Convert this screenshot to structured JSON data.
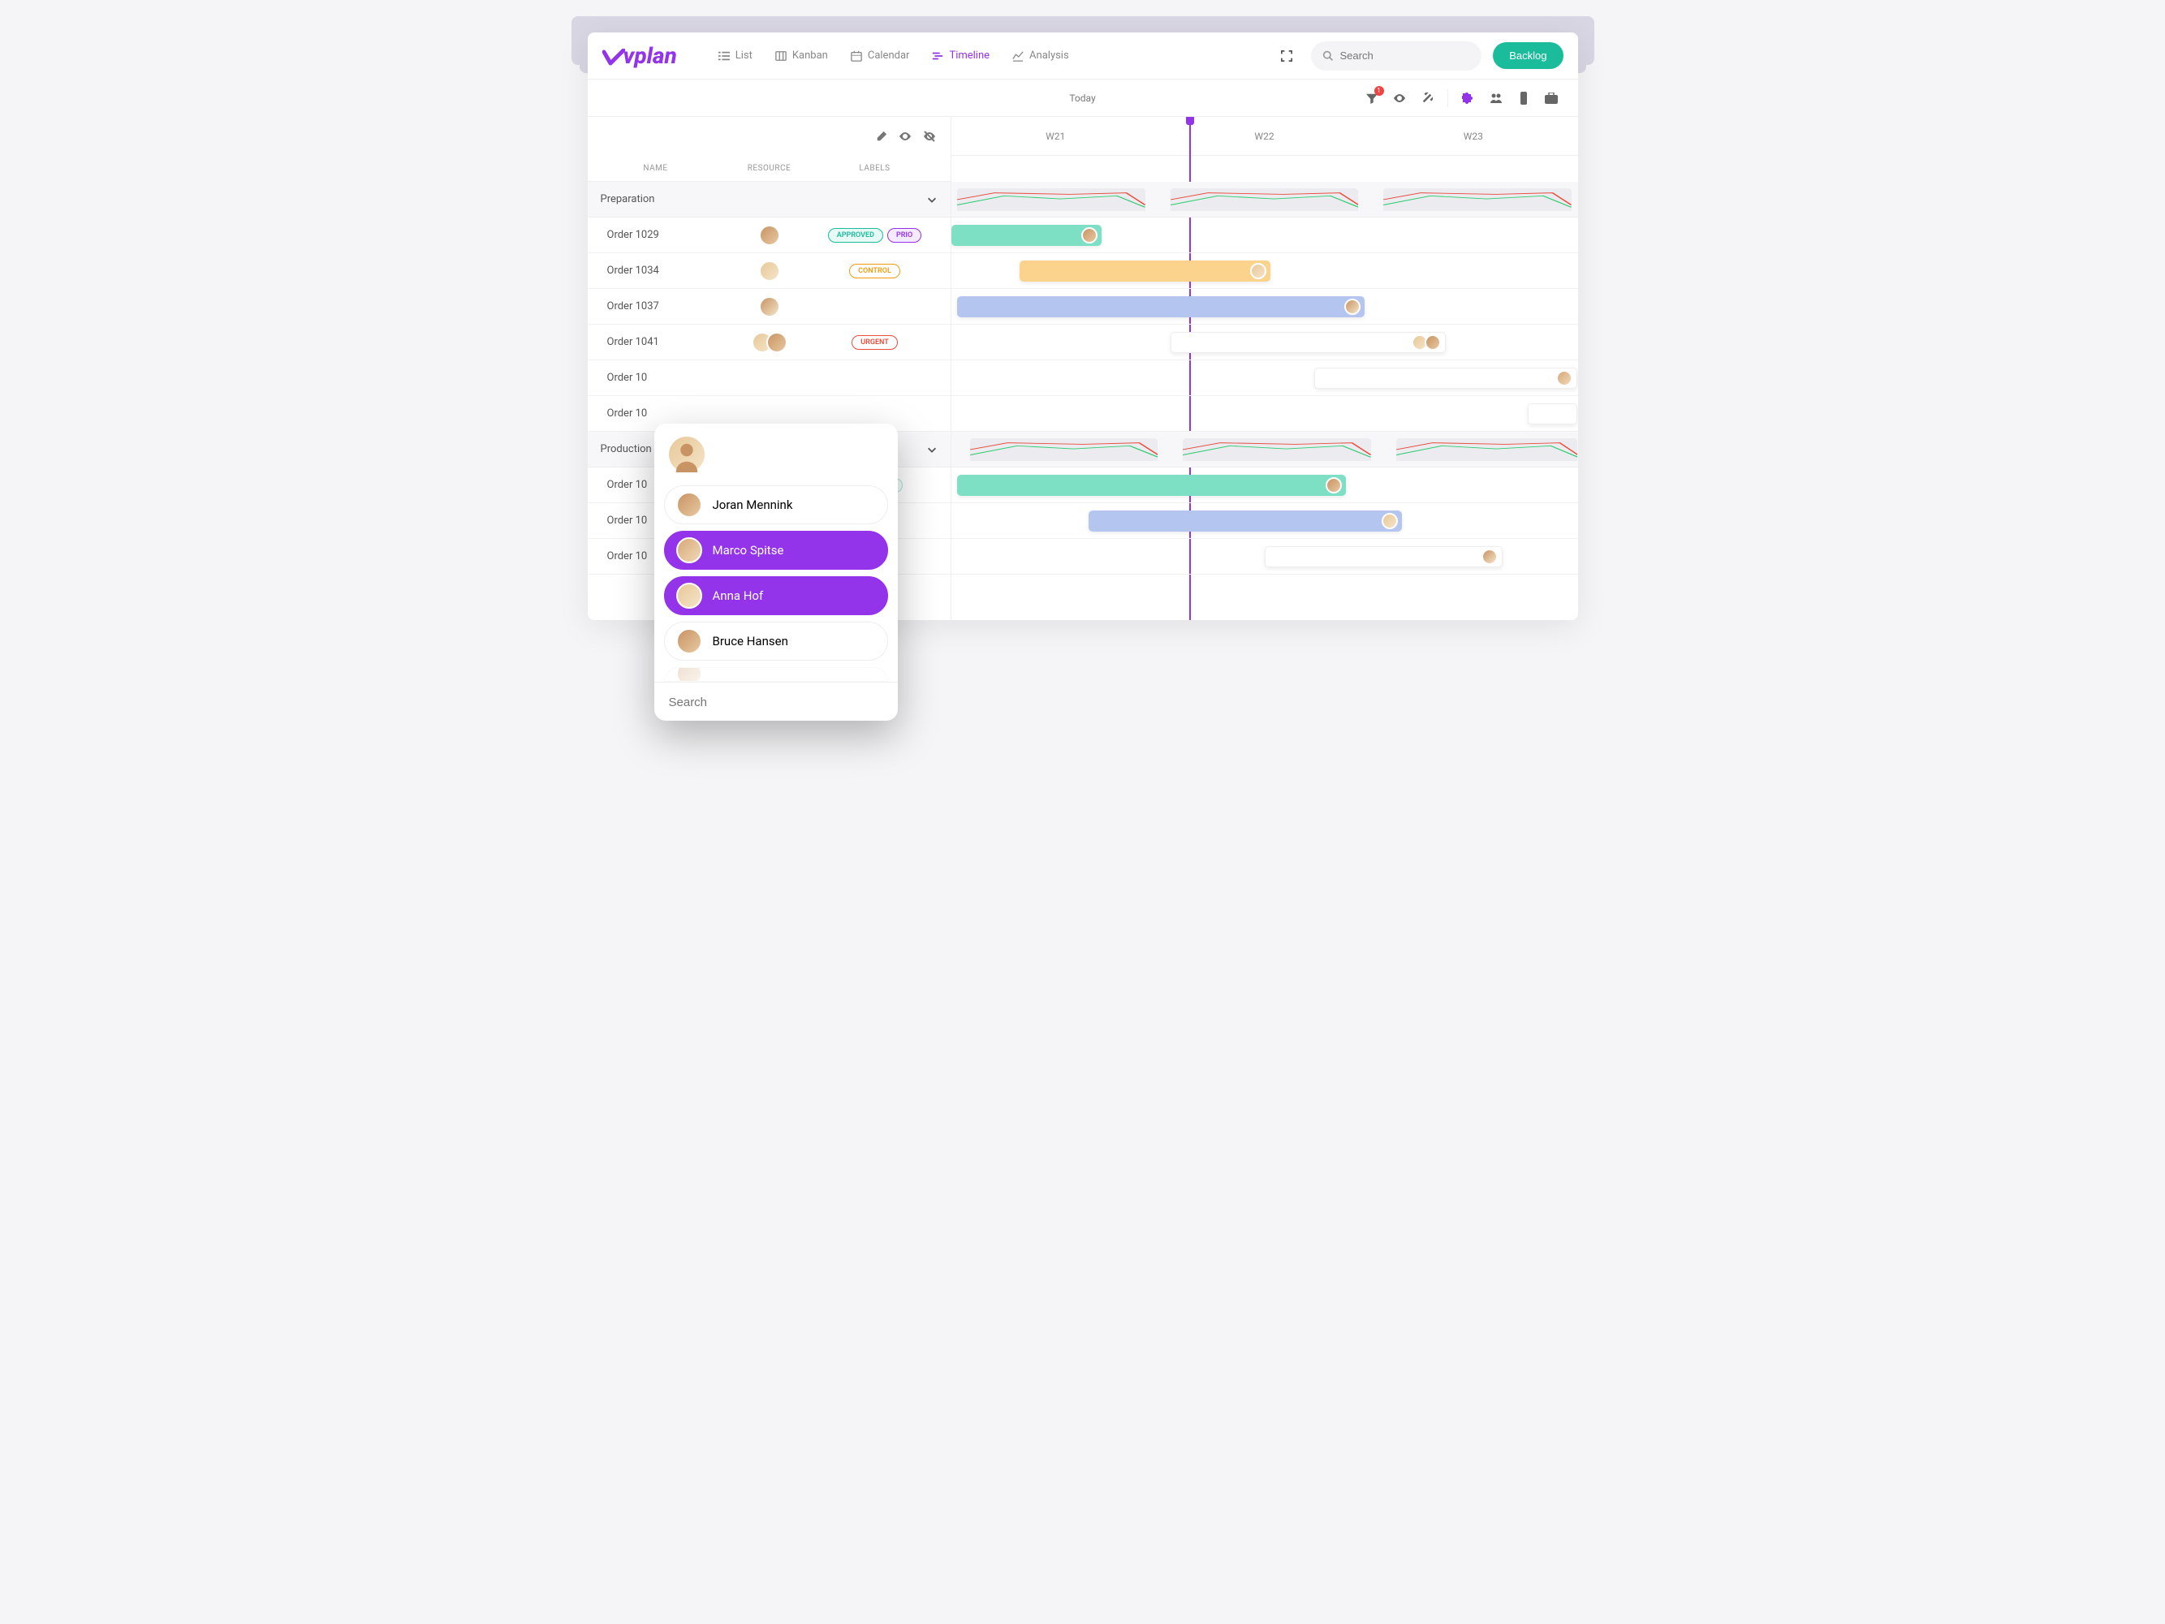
{
  "brand": "vplan",
  "views": {
    "list": "List",
    "kanban": "Kanban",
    "calendar": "Calendar",
    "timeline": "Timeline",
    "analysis": "Analysis"
  },
  "search_placeholder": "Search",
  "backlog": "Backlog",
  "today": "Today",
  "filter_badge": "1",
  "cols": {
    "name": "NAME",
    "resource": "RESOURCE",
    "labels": "LABELS"
  },
  "weeks": {
    "w21": "W21",
    "w22": "W22",
    "w23": "W23"
  },
  "groups": {
    "prep": "Preparation",
    "prod": "Production"
  },
  "labels": {
    "approved": "APPROVED",
    "prio": "PRIO",
    "control": "CONTROL",
    "urgent": "URGENT"
  },
  "orders": {
    "r1": "Order 1029",
    "r2": "Order 1034",
    "r3": "Order 1037",
    "r4": "Order 1041",
    "r5": "Order 10",
    "r6": "Order 10",
    "p1": "Order 10",
    "p2": "Order 10",
    "p3": "Order 10"
  },
  "people": {
    "joran": "Joran Mennink",
    "marco": "Marco Spitse",
    "anna": "Anna Hof",
    "bruce": "Bruce Hansen"
  },
  "popup_search": "Search"
}
